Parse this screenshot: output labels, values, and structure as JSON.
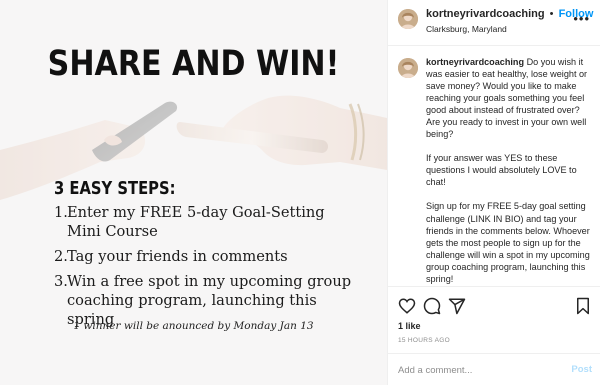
{
  "image": {
    "title": "SHARE AND WIN!",
    "steps_heading": "3 EASY STEPS:",
    "steps": [
      {
        "num": "1.",
        "text": "Enter my FREE 5-day Goal-Setting Mini Course"
      },
      {
        "num": "2.",
        "text": "Tag your friends in comments"
      },
      {
        "num": "3.",
        "text": "Win a free spot in my upcoming group coaching program, launching this spring"
      }
    ],
    "footnote": "1 winner will be anounced by Monday Jan 13"
  },
  "header": {
    "username": "kortneyrivardcoaching",
    "dot": "•",
    "follow_label": "Follow",
    "location": "Clarksburg, Maryland",
    "more_icon": "more-horizontal-icon"
  },
  "caption": {
    "username": "kortneyrivardcoaching",
    "paragraphs": [
      "Do you wish it was easier to eat healthy, lose weight or save money? Would you like to make reaching your goals something you feel good about instead of frustrated over? Are you ready to invest in your own well being?",
      "If your answer was YES to these questions I would absolutely LOVE to chat!",
      "Sign up for my FREE 5-day goal setting challenge (LINK IN BIO) and tag your friends in the comments below. Whoever gets the most people to sign up for the challenge will win a spot in my upcoming group coaching program, launching this spring!"
    ]
  },
  "actions": {
    "icons": [
      "heart-icon",
      "comment-icon",
      "share-icon",
      "bookmark-icon"
    ],
    "likes": "1 like",
    "timestamp": "15 HOURS AGO"
  },
  "comment": {
    "placeholder": "Add a comment...",
    "post_label": "Post"
  },
  "colors": {
    "accent": "#0095f6",
    "post_disabled": "#b2dffc",
    "text": "#262626",
    "muted": "#8e8e8e"
  }
}
